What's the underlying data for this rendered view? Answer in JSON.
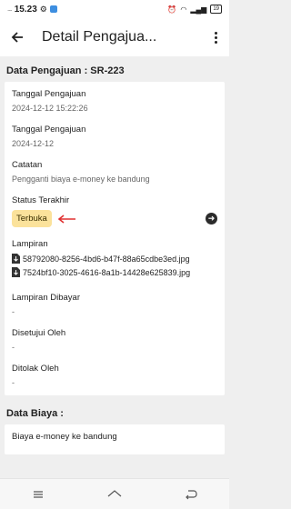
{
  "status_bar": {
    "time": "15.23",
    "battery": "19"
  },
  "app_bar": {
    "title": "Detail Pengajua..."
  },
  "section1_title": "Data Pengajuan : SR-223",
  "fields": [
    {
      "label": "Tanggal Pengajuan",
      "value": "2024-12-12 15:22:26"
    },
    {
      "label": "Tanggal Pengajuan",
      "value": "2024-12-12"
    },
    {
      "label": "Catatan",
      "value": "Pengganti biaya e-money ke bandung"
    }
  ],
  "status": {
    "label": "Status Terakhir",
    "badge": "Terbuka",
    "badge_color": "#fbe29b",
    "arrow_color": "#e03030"
  },
  "lampiran": {
    "label": "Lampiran",
    "files": [
      "58792080-8256-4bd6-b47f-88a65cdbe3ed.jpg",
      "7524bf10-3025-4616-8a1b-14428e625839.jpg"
    ]
  },
  "fields2": [
    {
      "label": "Lampiran Dibayar",
      "value": "-"
    },
    {
      "label": "Disetujui Oleh",
      "value": "-"
    },
    {
      "label": "Ditolak Oleh",
      "value": "-"
    }
  ],
  "section2_title": "Data Biaya :",
  "biaya_item": "Biaya e-money ke bandung"
}
